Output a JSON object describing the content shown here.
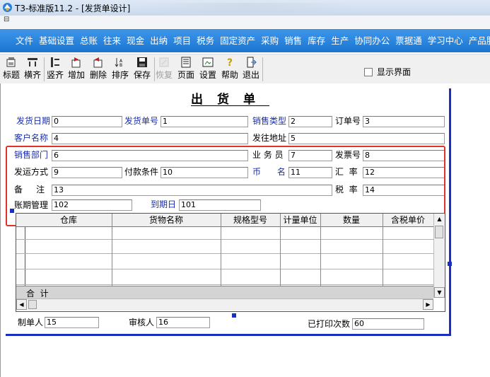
{
  "window": {
    "title": "T3-标准版11.2 - [发货单设计]",
    "system_menu_icon": "small-window-icon"
  },
  "menubar": {
    "items": [
      "文件",
      "基础设置",
      "总账",
      "往来",
      "现金",
      "出纳",
      "项目",
      "税务",
      "固定资产",
      "采购",
      "销售",
      "库存",
      "生产",
      "协同办公",
      "票据通",
      "学习中心",
      "产品服务"
    ]
  },
  "toolbar": {
    "buttons": [
      {
        "label": "标题",
        "icon": "title-icon",
        "enabled": true
      },
      {
        "label": "横齐",
        "icon": "align-horizontal-icon",
        "enabled": true
      },
      {
        "label": "竖齐",
        "icon": "align-vertical-icon",
        "enabled": true
      },
      {
        "label": "增加",
        "icon": "add-icon",
        "enabled": true
      },
      {
        "label": "删除",
        "icon": "delete-icon",
        "enabled": true
      },
      {
        "label": "排序",
        "icon": "sort-icon",
        "enabled": true
      },
      {
        "label": "保存",
        "icon": "save-icon",
        "enabled": true
      },
      {
        "label": "恢复",
        "icon": "restore-icon",
        "enabled": false
      },
      {
        "label": "页面",
        "icon": "page-icon",
        "enabled": true
      },
      {
        "label": "设置",
        "icon": "settings-icon",
        "enabled": true
      },
      {
        "label": "帮助",
        "icon": "help-icon",
        "enabled": true
      },
      {
        "label": "退出",
        "icon": "exit-icon",
        "enabled": true
      }
    ],
    "show_ui_label": "显示界面",
    "show_ui_checked": false
  },
  "document": {
    "title": "出货单",
    "fields": {
      "ship_date": {
        "label": "发货日期",
        "value": "0"
      },
      "ship_no": {
        "label": "发货单号",
        "value": "1"
      },
      "sales_type": {
        "label": "销售类型",
        "value": "2"
      },
      "order_no": {
        "label": "订单号",
        "value": "3"
      },
      "customer_name": {
        "label": "客户名称",
        "value": "4"
      },
      "ship_address": {
        "label": "发往地址",
        "value": "5"
      },
      "sales_dept": {
        "label": "销售部门",
        "value": "6"
      },
      "salesman": {
        "label": "业 务 员",
        "value": "7"
      },
      "invoice_no": {
        "label": "发票号",
        "value": "8"
      },
      "ship_method": {
        "label": "发运方式",
        "value": "9"
      },
      "payment_terms": {
        "label": "付款条件",
        "value": "10"
      },
      "currency": {
        "label": "币      名",
        "value": "11"
      },
      "exchange_rate": {
        "label": "汇  率",
        "value": "12"
      },
      "remarks": {
        "label": "备     注",
        "value": "13"
      },
      "tax_rate": {
        "label": "税  率",
        "value": "14"
      },
      "aging_mgmt": {
        "label": "账期管理",
        "value": "102"
      },
      "due_date": {
        "label": "到期日",
        "value": "101"
      },
      "maker": {
        "label": "制单人",
        "value": "15"
      },
      "auditor": {
        "label": "审核人",
        "value": "16"
      },
      "print_count": {
        "label": "已打印次数",
        "value": "60"
      }
    },
    "grid": {
      "columns": [
        "仓库",
        "货物名称",
        "规格型号",
        "计量单位",
        "数量",
        "含税单价"
      ],
      "total_label": "合  计"
    }
  },
  "colors": {
    "menubar_bg": "#2a86e0",
    "label_blue": "#1a2fa8",
    "report_border": "#1a2fc2",
    "selection_red": "#e0312a"
  }
}
